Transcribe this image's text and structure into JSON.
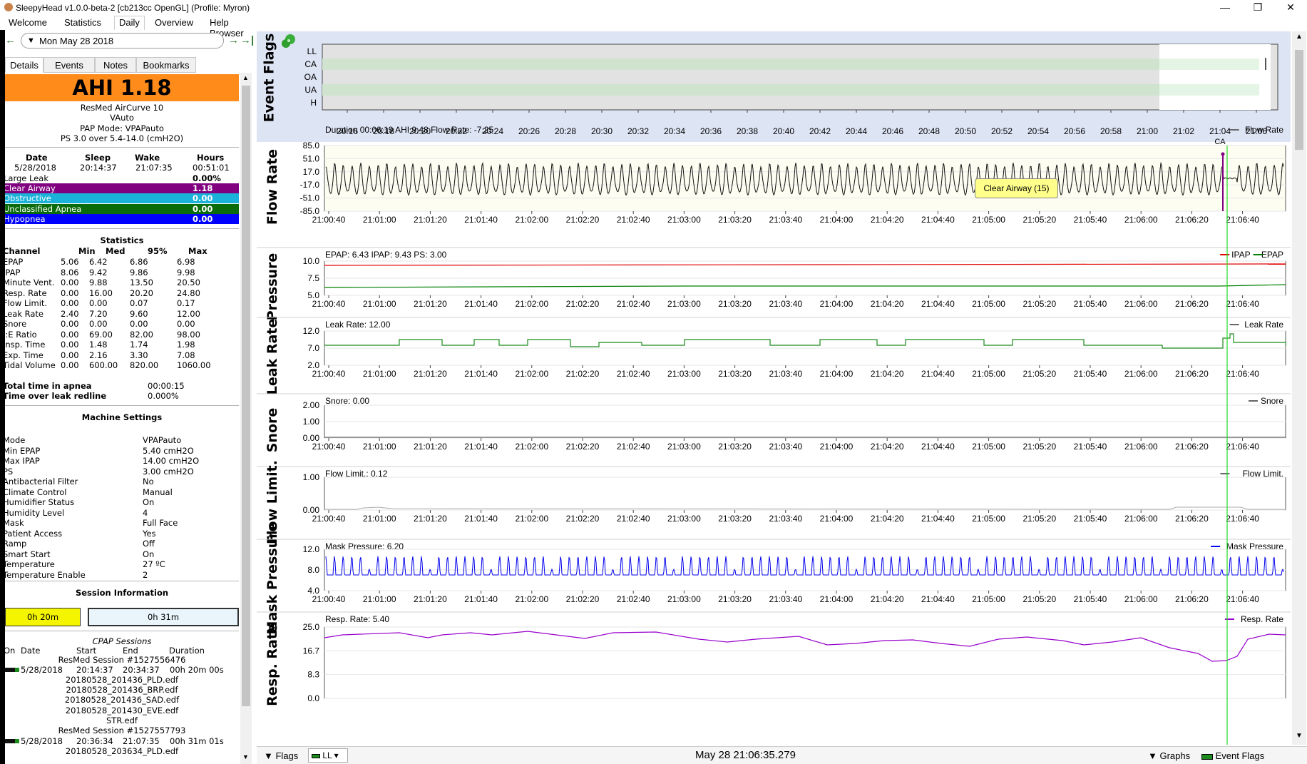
{
  "window": {
    "title": "SleepyHead v1.0.0-beta-2 [cb213cc OpenGL] (Profile: Myron)",
    "min": "—",
    "max": "❐",
    "close": "✕"
  },
  "menu": [
    "Welcome",
    "Statistics",
    "Daily",
    "Overview",
    "Help Browser"
  ],
  "date_nav": {
    "prev": "←",
    "date": "Mon May 28 2018",
    "next": "→",
    "last": "→|"
  },
  "tabs": [
    "Details",
    "Events",
    "Notes",
    "Bookmarks"
  ],
  "details": {
    "ahi": "AHI 1.18",
    "machine": "ResMed AirCurve 10",
    "model": "VAuto",
    "pap_mode": "PAP Mode: VPAPauto",
    "pressure": "PS 3.0 over 5.4-14.0 (cmH2O)",
    "summary_headers": [
      "Date",
      "Sleep",
      "Wake",
      "Hours"
    ],
    "summary_values": [
      "5/28/2018",
      "20:14:37",
      "21:07:35",
      "00:51:01"
    ],
    "events": [
      {
        "label": "Large Leak",
        "value": "0.00%",
        "color": "#ffffff",
        "text": "#000000"
      },
      {
        "label": "Clear Airway",
        "value": "1.18",
        "color": "#800080",
        "text": "#ffffff"
      },
      {
        "label": "Obstructive",
        "value": "0.00",
        "color": "#1ab2d8",
        "text": "#ffffff"
      },
      {
        "label": "Unclassified Apnea",
        "value": "0.00",
        "color": "#0a6b0a",
        "text": "#ffffff"
      },
      {
        "label": "Hypopnea",
        "value": "0.00",
        "color": "#0000ff",
        "text": "#ffffff"
      }
    ],
    "stats_title": "Statistics",
    "stats_headers": [
      "Channel",
      "Min",
      "Med",
      "95%",
      "Max"
    ],
    "stats": [
      [
        "EPAP",
        "5.06",
        "6.42",
        "6.86",
        "6.98"
      ],
      [
        "IPAP",
        "8.06",
        "9.42",
        "9.86",
        "9.98"
      ],
      [
        "Minute Vent.",
        "0.00",
        "9.88",
        "13.50",
        "20.50"
      ],
      [
        "Resp. Rate",
        "0.00",
        "16.00",
        "20.20",
        "24.80"
      ],
      [
        "Flow Limit.",
        "0.00",
        "0.00",
        "0.07",
        "0.17"
      ],
      [
        "Leak Rate",
        "2.40",
        "7.20",
        "9.60",
        "12.00"
      ],
      [
        "Snore",
        "0.00",
        "0.00",
        "0.00",
        "0.00"
      ],
      [
        "I:E Ratio",
        "0.00",
        "69.00",
        "82.00",
        "98.00"
      ],
      [
        "Insp. Time",
        "0.00",
        "1.48",
        "1.74",
        "1.98"
      ],
      [
        "Exp. Time",
        "0.00",
        "2.16",
        "3.30",
        "7.08"
      ],
      [
        "Tidal Volume",
        "0.00",
        "600.00",
        "820.00",
        "1060.00"
      ]
    ],
    "total_apnea_label": "Total time in apnea",
    "total_apnea_value": "00:00:15",
    "leak_redline_label": "Time over leak redline",
    "leak_redline_value": "0.000%",
    "settings_title": "Machine Settings",
    "settings": [
      [
        "Mode",
        "VPAPauto"
      ],
      [
        "Min EPAP",
        "5.40 cmH2O"
      ],
      [
        "Max IPAP",
        "14.00 cmH2O"
      ],
      [
        "PS",
        "3.00 cmH2O"
      ],
      [
        "Antibacterial Filter",
        "No"
      ],
      [
        "Climate Control",
        "Manual"
      ],
      [
        "Humidifier Status",
        "On"
      ],
      [
        "Humidity Level",
        "4"
      ],
      [
        "Mask",
        "Full Face"
      ],
      [
        "Patient Access",
        "Yes"
      ],
      [
        "Ramp",
        "Off"
      ],
      [
        "Smart Start",
        "On"
      ],
      [
        "Temperature",
        "27 ºC"
      ],
      [
        "Temperature Enable",
        "2"
      ]
    ],
    "session_title": "Session Information",
    "session_durations": [
      "0h 20m",
      "0h 31m"
    ],
    "cpap_sessions_title": "CPAP Sessions",
    "cpap_headers": [
      "On",
      "Date",
      "Start",
      "End",
      "Duration"
    ],
    "sessions": [
      {
        "title": "ResMed Session #1527556476",
        "date": "5/28/2018",
        "start": "20:14:37",
        "end": "20:34:37",
        "duration": "00h 20m 00s",
        "files": [
          "20180528_201436_PLD.edf",
          "20180528_201436_BRP.edf",
          "20180528_201436_SAD.edf",
          "20180528_201430_EVE.edf",
          "STR.edf"
        ]
      },
      {
        "title": "ResMed Session #1527557793",
        "date": "5/28/2018",
        "start": "20:36:34",
        "end": "21:07:35",
        "duration": "00h 31m 01s",
        "files": [
          "20180528_203634_PLD.edf"
        ]
      }
    ]
  },
  "event_flags": {
    "label": "Event Flags",
    "rows": [
      "LL",
      "CA",
      "OA",
      "UA",
      "H"
    ],
    "xticks": [
      "20:16",
      "20:18",
      "20:20",
      "20:22",
      "20:24",
      "20:26",
      "20:28",
      "20:30",
      "20:32",
      "20:34",
      "20:36",
      "20:38",
      "20:40",
      "20:42",
      "20:44",
      "20:46",
      "20:48",
      "20:50",
      "20:52",
      "20:54",
      "20:56",
      "20:58",
      "21:00",
      "21:02",
      "21:04",
      "21:06"
    ]
  },
  "xticks": [
    "21:00:40",
    "21:01:00",
    "21:01:20",
    "21:01:40",
    "21:02:00",
    "21:02:20",
    "21:02:40",
    "21:03:00",
    "21:03:20",
    "21:03:40",
    "21:04:00",
    "21:04:20",
    "21:04:40",
    "21:05:00",
    "21:05:20",
    "21:05:40",
    "21:06:00",
    "21:06:20",
    "21:06:40"
  ],
  "chart_data": [
    {
      "type": "line",
      "title": "Duration 00:06:19 AHI 9.48 Flow Rate: -7.25",
      "ylabel": "Flow Rate",
      "legend": [
        "Flow Rate"
      ],
      "yticks": [
        "85.0",
        "51.0",
        "17.0",
        "-17.0",
        "-51.0",
        "-85.0"
      ],
      "ylim": [
        -85,
        85
      ],
      "annotation": "Clear Airway (15)",
      "event_marker": "CA"
    },
    {
      "type": "line",
      "title": "EPAP: 6.43 IPAP: 9.43 PS: 3.00",
      "ylabel": "Pressure",
      "legend": [
        "IPAP",
        "EPAP"
      ],
      "yticks": [
        "10.0",
        "7.5",
        "5.0"
      ],
      "ylim": [
        5,
        10
      ],
      "series": [
        {
          "name": "IPAP",
          "value": 9.43,
          "color": "#e00000"
        },
        {
          "name": "EPAP",
          "value": 6.43,
          "color": "#008000"
        }
      ]
    },
    {
      "type": "line",
      "title": "Leak Rate: 12.00",
      "ylabel": "Leak Rate",
      "legend": [
        "Leak Rate"
      ],
      "yticks": [
        "12.0",
        "7.0",
        "2.0"
      ],
      "ylim": [
        2,
        12
      ]
    },
    {
      "type": "line",
      "title": "Snore: 0.00",
      "ylabel": "Snore",
      "legend": [
        "Snore"
      ],
      "yticks": [
        "2.00",
        "1.00",
        "0.00"
      ],
      "ylim": [
        0,
        2
      ]
    },
    {
      "type": "line",
      "title": "Flow Limit.: 0.12",
      "ylabel": "Flow Limit.",
      "legend": [
        "Flow Limit."
      ],
      "yticks": [
        "1.00",
        "0.00"
      ],
      "ylim": [
        0,
        1
      ]
    },
    {
      "type": "line",
      "title": "Mask Pressure: 6.20",
      "ylabel": "Mask Pressure",
      "legend": [
        "Mask Pressure"
      ],
      "yticks": [
        "12.0",
        "8.0",
        "4.0"
      ],
      "ylim": [
        4,
        12
      ]
    },
    {
      "type": "line",
      "title": "Resp. Rate: 5.40",
      "ylabel": "Resp. Rate",
      "legend": [
        "Resp. Rate"
      ],
      "yticks": [
        "25.0",
        "16.7",
        "8.3",
        "0.0"
      ],
      "ylim": [
        0,
        25
      ]
    }
  ],
  "bottom": {
    "flags": "Flags",
    "ll": "LL",
    "timestamp": "May 28 21:06:35.279",
    "graphs": "Graphs",
    "event_flags": "Event Flags"
  }
}
